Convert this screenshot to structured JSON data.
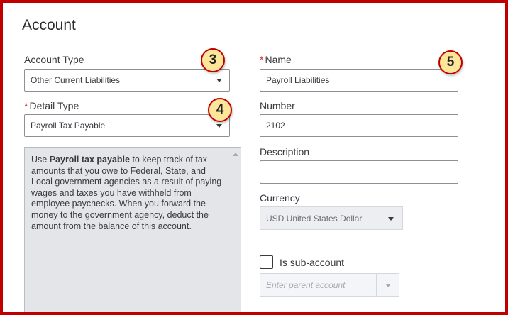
{
  "header": {
    "title": "Account"
  },
  "account_type": {
    "label": "Account Type",
    "value": "Other Current Liabilities"
  },
  "detail_type": {
    "required_mark": "*",
    "label": "Detail Type",
    "value": "Payroll Tax Payable"
  },
  "description_box": {
    "text_before": "Use ",
    "bold": "Payroll tax payable",
    "text_after": " to keep track of tax amounts that you owe to Federal, State, and Local government agencies as a result of paying wages and taxes you have withheld from employee paychecks. When you forward the money to the government agency, deduct the amount from the balance of this account."
  },
  "name": {
    "required_mark": "*",
    "label": "Name",
    "value": "Payroll Liabilities"
  },
  "number": {
    "label": "Number",
    "value": "2102"
  },
  "description": {
    "label": "Description",
    "value": ""
  },
  "currency": {
    "label": "Currency",
    "value": "USD United States Dollar"
  },
  "sub_account": {
    "label": "Is sub-account",
    "placeholder": "Enter parent account"
  },
  "callouts": {
    "account_type": "3",
    "detail_type": "4",
    "name": "5"
  },
  "colors": {
    "frame": "#c00000",
    "badge_fill": "#fde59a",
    "required": "#d52b1e"
  }
}
